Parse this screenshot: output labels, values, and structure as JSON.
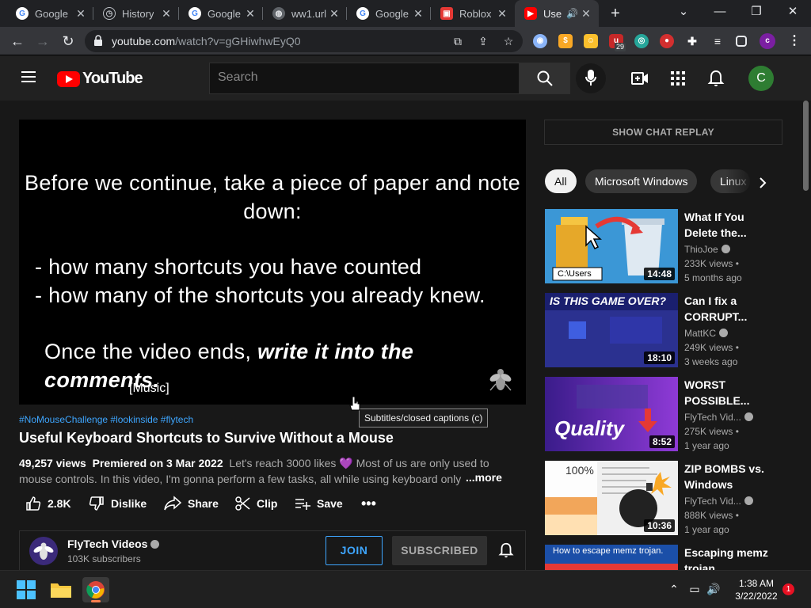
{
  "browser": {
    "tabs": [
      {
        "title": "Google",
        "favicon": "google-icon"
      },
      {
        "title": "History",
        "favicon": "history-icon"
      },
      {
        "title": "Google",
        "favicon": "google-icon"
      },
      {
        "title": "ww1.url",
        "favicon": "globe-icon"
      },
      {
        "title": "Google",
        "favicon": "google-icon"
      },
      {
        "title": "Roblox",
        "favicon": "roblox-icon"
      },
      {
        "title": "Use",
        "favicon": "youtube-icon"
      }
    ],
    "url_host": "youtube.com",
    "url_path": "/watch?v=gGHiwhwEyQ0",
    "extension_badge": "29",
    "profile_letter": "c"
  },
  "youtube": {
    "logo_text": "YouTube",
    "search_placeholder": "Search",
    "avatar_letter": "C"
  },
  "video": {
    "overlay_line1": "Before we continue, take a piece of paper and note down:",
    "overlay_line2": "- how many shortcuts you have counted",
    "overlay_line3": "- how many of the shortcuts you already knew.",
    "overlay_line4_a": "Once the video ends, ",
    "overlay_line4_b": "write it into the comments.",
    "caption": "[Music]",
    "tooltip": "Subtitles/closed captions (c)",
    "hashtags": "#NoMouseChallenge #lookinside #flytech",
    "title": "Useful Keyboard Shortcuts to Survive Without a Mouse",
    "views": "49,257 views",
    "premiered": "Premiered on 3 Mar 2022",
    "description_line1": "Let's reach 3000 likes 💜 Most of us are only used to",
    "description_line2": "mouse controls. In this video, I'm gonna perform a few tasks, all while using keyboard only",
    "more_label": "...more",
    "likes": "2.8K",
    "dislike_label": "Dislike",
    "share_label": "Share",
    "clip_label": "Clip",
    "save_label": "Save"
  },
  "channel": {
    "name": "FlyTech Videos",
    "subscribers": "103K subscribers",
    "join_label": "JOIN",
    "subscribed_label": "SUBSCRIBED"
  },
  "sidebar": {
    "chat_replay_label": "SHOW CHAT REPLAY",
    "chips": [
      "All",
      "Microsoft Windows",
      "Linux"
    ],
    "recommendations": [
      {
        "title": "What If You Delete the...",
        "channel": "ThioJoe",
        "views": "233K views •",
        "age": "5 months ago",
        "duration": "14:48",
        "thumb_text": "C:\\Users"
      },
      {
        "title": "Can I fix a CORRUPT...",
        "channel": "MattKC",
        "views": "249K views •",
        "age": "3 weeks ago",
        "duration": "18:10",
        "thumb_text": "IS THIS GAME OVER?"
      },
      {
        "title": "WORST POSSIBLE...",
        "channel": "FlyTech Vid...",
        "views": "275K views •",
        "age": "1 year ago",
        "duration": "8:52",
        "thumb_text": "Quality"
      },
      {
        "title": "ZIP BOMBS vs. Windows",
        "channel": "FlyTech Vid...",
        "views": "888K views •",
        "age": "1 year ago",
        "duration": "10:36",
        "thumb_text": "100%"
      },
      {
        "title": "Escaping memz trojan",
        "channel": "",
        "views": "",
        "age": "",
        "duration": "",
        "thumb_text": "How to escape memz trojan."
      }
    ]
  },
  "taskbar": {
    "time": "1:38 AM",
    "date": "3/22/2022",
    "notifications": "1"
  }
}
